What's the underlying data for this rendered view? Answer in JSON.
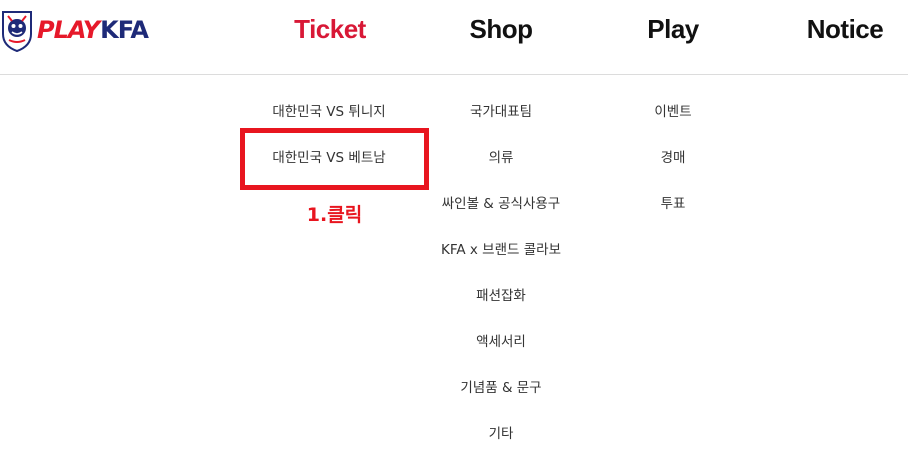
{
  "header": {
    "logo": {
      "play": "PLAY",
      "kfa": "KFA"
    },
    "nav": [
      {
        "label": "Ticket",
        "active": true
      },
      {
        "label": "Shop",
        "active": false
      },
      {
        "label": "Play",
        "active": false
      },
      {
        "label": "Notice",
        "active": false
      }
    ]
  },
  "menu": {
    "ticket": [
      "대한민국 VS 튀니지",
      "대한민국 VS 베트남"
    ],
    "shop": [
      "국가대표팀",
      "의류",
      "싸인볼 & 공식사용구",
      "KFA x 브랜드 콜라보",
      "패션잡화",
      "액세서리",
      "기념품 & 문구",
      "기타"
    ],
    "play": [
      "이벤트",
      "경매",
      "투표"
    ]
  },
  "annotation": {
    "label": "1.클릭",
    "color": "#e8151f"
  },
  "colors": {
    "active_nav": "#d81836",
    "brand_red": "#e6192a",
    "brand_navy": "#1e2a78"
  }
}
